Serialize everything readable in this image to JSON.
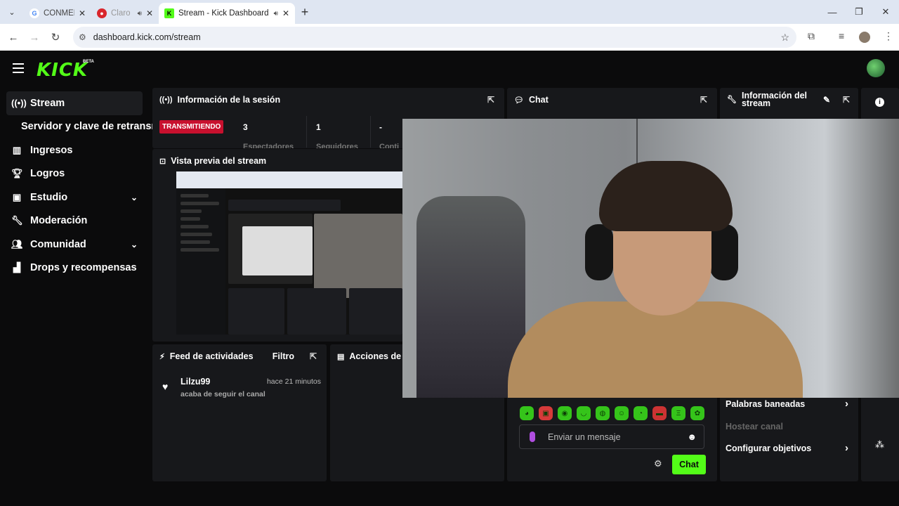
{
  "browser": {
    "tabs": [
      {
        "title": "CONMEB",
        "active": false
      },
      {
        "title": "Claro",
        "active": false
      },
      {
        "title": "Stream - Kick Dashboard",
        "active": true
      }
    ],
    "url": "dashboard.kick.com/stream"
  },
  "app": {
    "logo": "KICK",
    "logo_badge": "BETA"
  },
  "sidebar": {
    "items": [
      {
        "label": "Stream",
        "icon": "broadcast-icon"
      },
      {
        "label": "Servidor y clave de retransm",
        "icon": ""
      },
      {
        "label": "Ingresos",
        "icon": "bar-chart-icon"
      },
      {
        "label": "Logros",
        "icon": "trophy-icon"
      },
      {
        "label": "Estudio",
        "icon": "studio-icon"
      },
      {
        "label": "Moderación",
        "icon": "wrench-icon"
      },
      {
        "label": "Comunidad",
        "icon": "community-icon"
      },
      {
        "label": "Drops y recompensas",
        "icon": "drops-icon"
      }
    ]
  },
  "session": {
    "title": "Información de la sesión",
    "status_badge": "TRANSMITIENDO",
    "viewers": "3",
    "followers": "1",
    "third": "-",
    "viewers_label": "Espectadores",
    "followers_label": "Seguidores",
    "third_label": "Conti"
  },
  "preview": {
    "title": "Vista previa del stream"
  },
  "chat": {
    "title": "Chat",
    "placeholder": "Enviar un mensaje",
    "send_label": "Chat"
  },
  "stream_info": {
    "title": "Información del stream",
    "banned_words": "Palabras baneadas",
    "host_channel": "Hostear canal",
    "configure_goals": "Configurar objetivos"
  },
  "feed": {
    "title": "Feed de actividades",
    "filter_label": "Filtro",
    "entries": [
      {
        "user": "Lilzu99",
        "time": "hace 21 minutos",
        "action": "acaba de seguir el canal"
      }
    ]
  },
  "mod_actions": {
    "title": "Acciones de m"
  },
  "colors": {
    "brand": "#53fc18",
    "live": "#c8102e",
    "panel": "#17181b"
  }
}
